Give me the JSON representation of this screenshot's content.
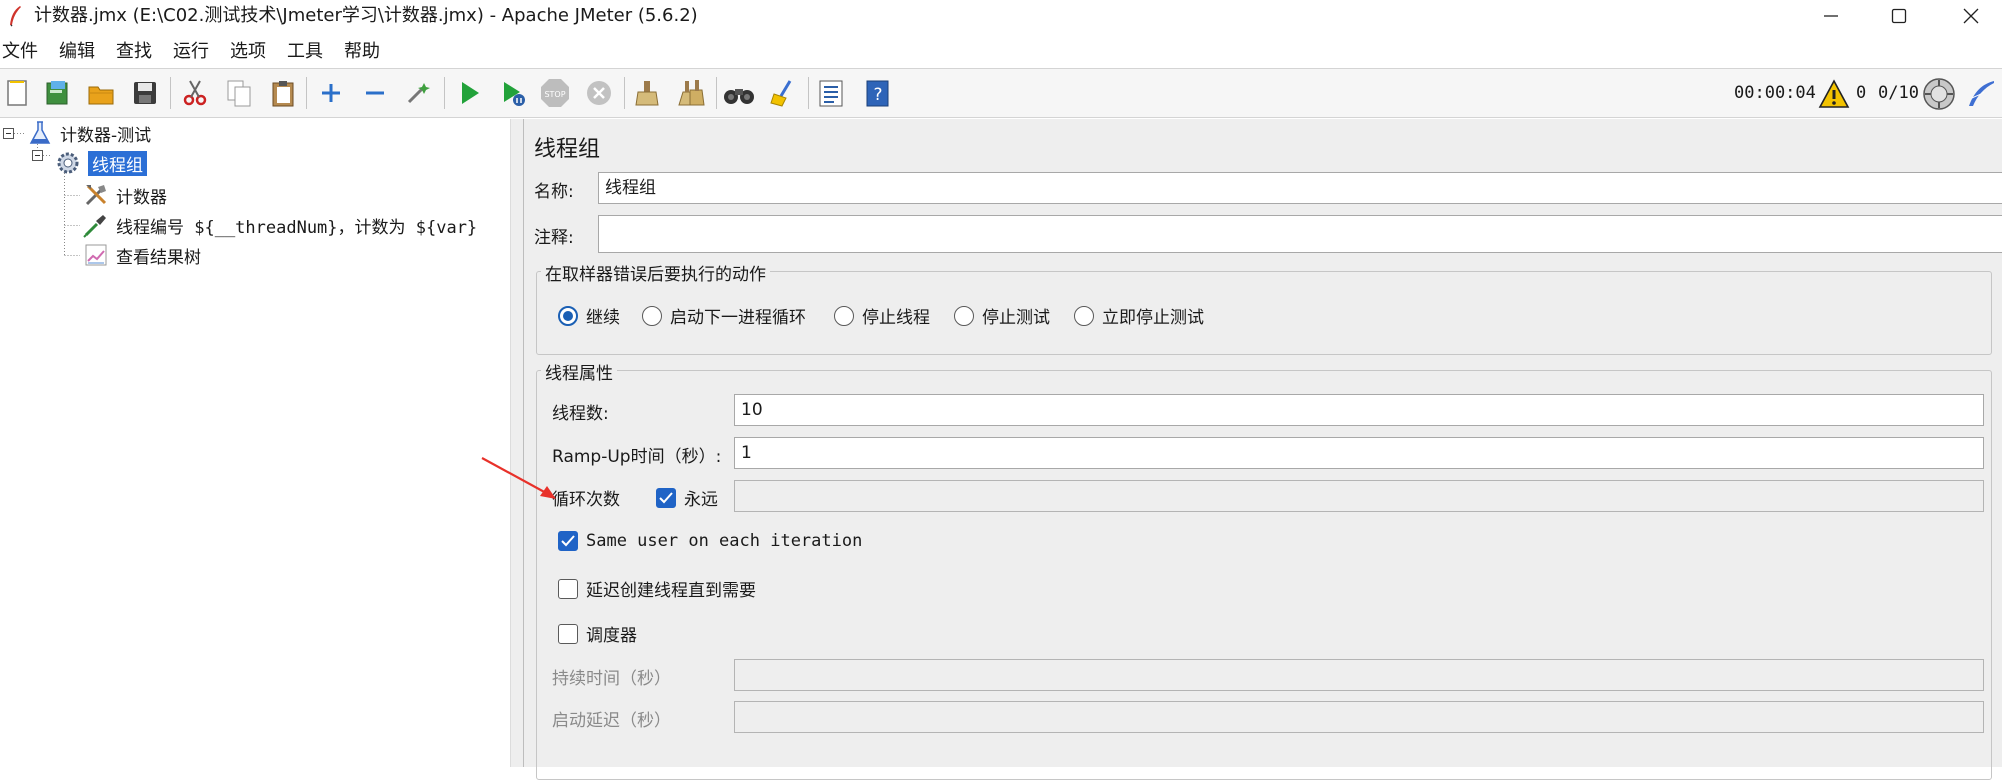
{
  "window": {
    "title": "计数器.jmx (E:\\C02.测试技术\\Jmeter学习\\计数器.jmx) - Apache JMeter (5.6.2)"
  },
  "menu": [
    "文件",
    "编辑",
    "查找",
    "运行",
    "选项",
    "工具",
    "帮助"
  ],
  "toolbar": {
    "timer": "00:00:04",
    "error_count": "0",
    "threads": "0/10"
  },
  "tree": {
    "items": [
      {
        "label": "计数器-测试",
        "icon": "test-plan-flask-icon"
      },
      {
        "label": "线程组",
        "icon": "thread-group-gear-icon",
        "selected": true
      },
      {
        "label": "计数器",
        "icon": "counter-tools-icon"
      },
      {
        "label": "线程编号 ${__threadNum}，计数为 ${var}",
        "icon": "sampler-pipette-icon"
      },
      {
        "label": "查看结果树",
        "icon": "result-tree-chart-icon"
      }
    ]
  },
  "panel": {
    "title": "线程组",
    "name_label": "名称:",
    "name_value": "线程组",
    "comment_label": "注释:",
    "comment_value": "",
    "error_action": {
      "title": "在取样器错误后要执行的动作",
      "options": [
        "继续",
        "启动下一进程循环",
        "停止线程",
        "停止测试",
        "立即停止测试"
      ],
      "selected": "继续"
    },
    "thread_props": {
      "title": "线程属性",
      "threads_label": "线程数:",
      "threads_value": "10",
      "rampup_label": "Ramp-Up时间（秒）:",
      "rampup_value": "1",
      "loop_label": "循环次数",
      "forever_label": "永远",
      "forever_checked": true,
      "loop_value": "",
      "same_user_label": "Same user on each iteration",
      "same_user_checked": true,
      "delay_create_label": "延迟创建线程直到需要",
      "delay_create_checked": false,
      "scheduler_label": "调度器",
      "scheduler_checked": false,
      "duration_label": "持续时间（秒）",
      "duration_value": "",
      "startup_delay_label": "启动延迟（秒）",
      "startup_delay_value": ""
    }
  },
  "colors": {
    "selection": "#2b6fd6",
    "checkbox_blue": "#1f63c6",
    "annotation_arrow": "#e8312a"
  }
}
